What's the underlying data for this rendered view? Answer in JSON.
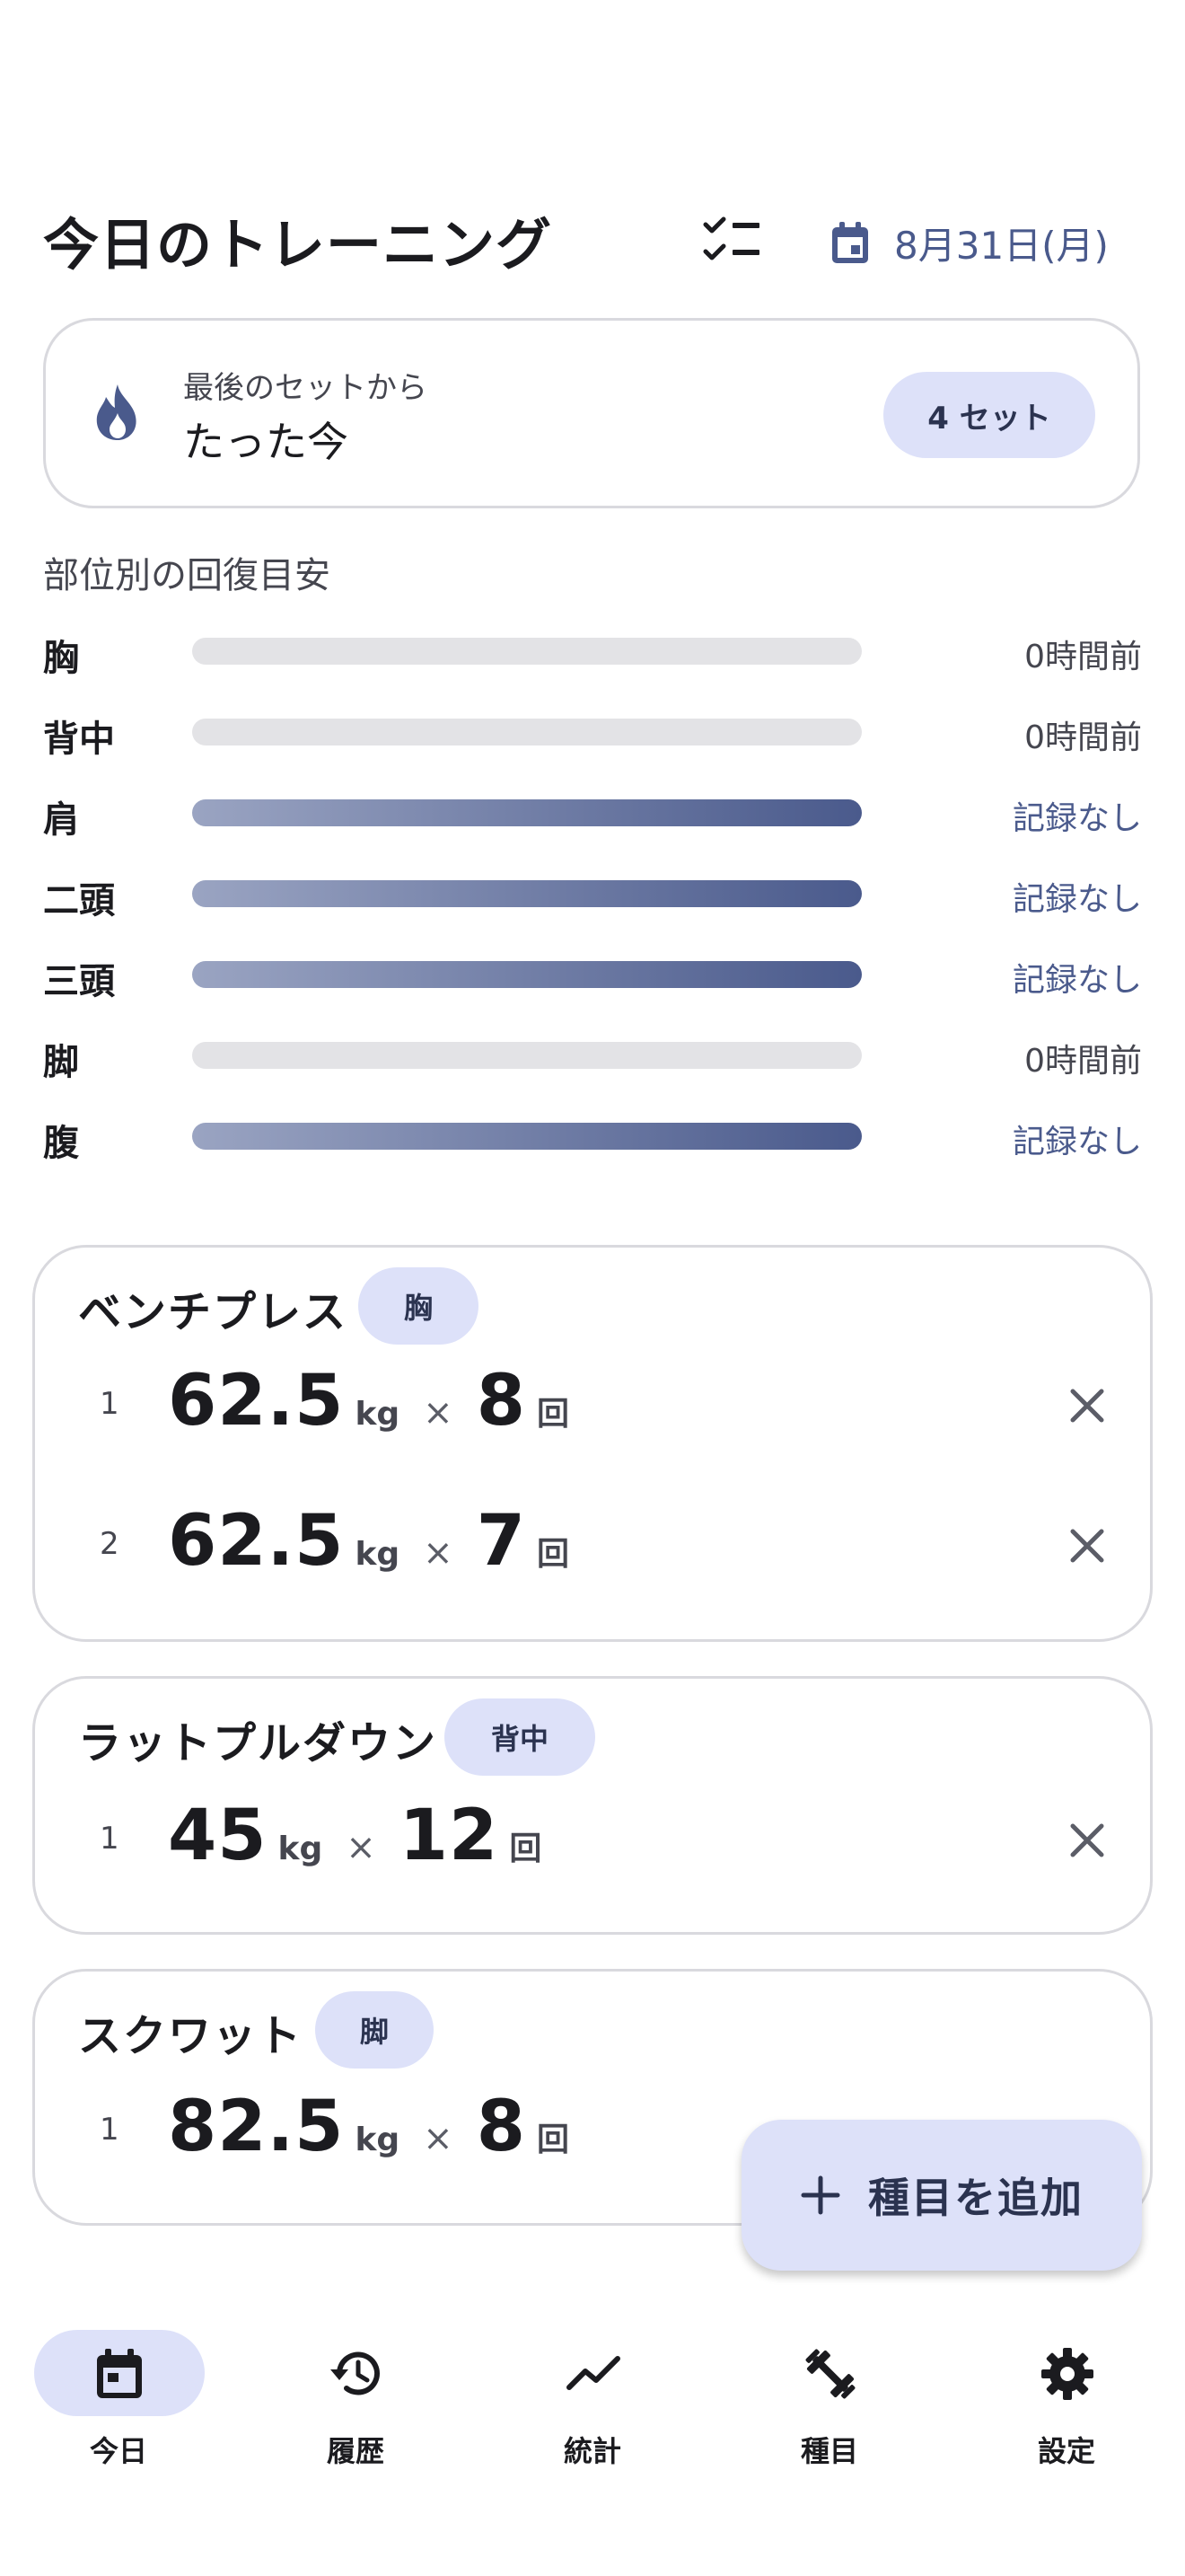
{
  "header": {
    "title": "今日のトレーニング",
    "date_label": "8月31日(月)",
    "checklist_icon": "checklist-icon",
    "calendar_icon": "calendar-icon"
  },
  "last_set": {
    "label": "最後のセットから",
    "value": "たった今",
    "set_count": "4 セット",
    "icon": "flame-icon"
  },
  "recovery": {
    "title": "部位別の回復目安",
    "rows": [
      {
        "part": "胸",
        "status": "0時間前",
        "recovered": false
      },
      {
        "part": "背中",
        "status": "0時間前",
        "recovered": false
      },
      {
        "part": "肩",
        "status": "記録なし",
        "recovered": true
      },
      {
        "part": "二頭",
        "status": "記録なし",
        "recovered": true
      },
      {
        "part": "三頭",
        "status": "記録なし",
        "recovered": true
      },
      {
        "part": "脚",
        "status": "0時間前",
        "recovered": false
      },
      {
        "part": "腹",
        "status": "記録なし",
        "recovered": true
      }
    ]
  },
  "exercises": [
    {
      "name": "ベンチプレス",
      "tag": "胸",
      "sets": [
        {
          "num": "1",
          "weight": "62.5",
          "weight_unit": "kg",
          "times": "×",
          "reps": "8",
          "reps_unit": "回"
        },
        {
          "num": "2",
          "weight": "62.5",
          "weight_unit": "kg",
          "times": "×",
          "reps": "7",
          "reps_unit": "回"
        }
      ]
    },
    {
      "name": "ラットプルダウン",
      "tag": "背中",
      "sets": [
        {
          "num": "1",
          "weight": "45",
          "weight_unit": "kg",
          "times": "×",
          "reps": "12",
          "reps_unit": "回"
        }
      ]
    },
    {
      "name": "スクワット",
      "tag": "脚",
      "sets": [
        {
          "num": "1",
          "weight": "82.5",
          "weight_unit": "kg",
          "times": "×",
          "reps": "8",
          "reps_unit": "回"
        }
      ]
    }
  ],
  "fab": {
    "label": "種目を追加",
    "icon": "plus-icon"
  },
  "nav": [
    {
      "label": "今日",
      "icon": "calendar-icon",
      "active": true
    },
    {
      "label": "履歴",
      "icon": "history-icon",
      "active": false
    },
    {
      "label": "統計",
      "icon": "trending-icon",
      "active": false
    },
    {
      "label": "種目",
      "icon": "dumbbell-icon",
      "active": false
    },
    {
      "label": "設定",
      "icon": "gear-icon",
      "active": false
    }
  ],
  "colors": {
    "accent": "#4a5a8c",
    "tonal_container": "#dde1f9",
    "bar_track": "#e3e3e6",
    "outline": "#d9d9de"
  }
}
